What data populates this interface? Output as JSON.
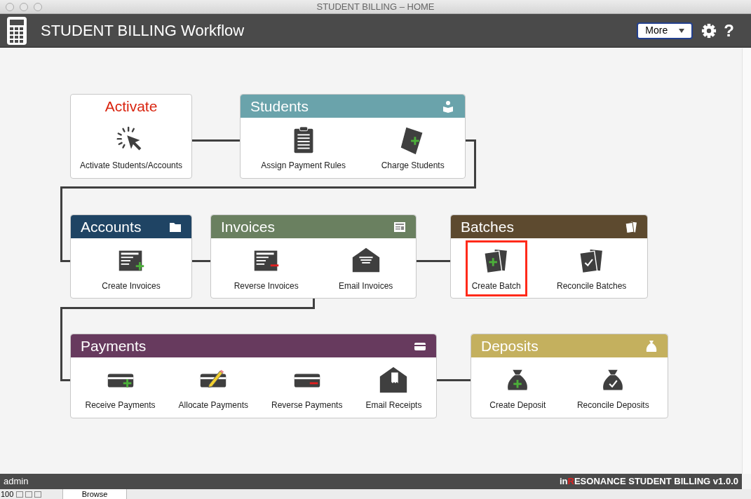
{
  "window": {
    "title": "STUDENT BILLING – HOME"
  },
  "header": {
    "title": "STUDENT BILLING Workflow",
    "menu": {
      "value": "More"
    },
    "help": "?"
  },
  "cards": [
    {
      "kind": "plain",
      "title": "Activate",
      "actions": [
        {
          "label": "Activate Students/Accounts",
          "selected": false
        }
      ]
    },
    {
      "kind": "banner",
      "title": "Students",
      "color": "#6aa3ab",
      "actions": [
        {
          "label": "Assign Payment Rules",
          "selected": false
        },
        {
          "label": "Charge Students",
          "selected": false
        }
      ]
    },
    {
      "kind": "banner",
      "title": "Accounts",
      "color": "#1f4464",
      "actions": [
        {
          "label": "Create Invoices",
          "selected": false
        }
      ]
    },
    {
      "kind": "banner",
      "title": "Invoices",
      "color": "#6a8060",
      "actions": [
        {
          "label": "Reverse Invoices",
          "selected": false
        },
        {
          "label": "Email Invoices",
          "selected": false
        }
      ]
    },
    {
      "kind": "banner",
      "title": "Batches",
      "color": "#5d4a2f",
      "actions": [
        {
          "label": "Create Batch",
          "selected": true
        },
        {
          "label": "Reconcile Batches",
          "selected": false
        }
      ]
    },
    {
      "kind": "banner",
      "title": "Payments",
      "color": "#673a5e",
      "actions": [
        {
          "label": "Receive Payments",
          "selected": false
        },
        {
          "label": "Allocate Payments",
          "selected": false
        },
        {
          "label": "Reverse Payments",
          "selected": false
        },
        {
          "label": "Email Receipts",
          "selected": false
        }
      ]
    },
    {
      "kind": "banner",
      "title": "Deposits",
      "color": "#c4b05e",
      "actions": [
        {
          "label": "Create Deposit",
          "selected": false
        },
        {
          "label": "Reconcile Deposits",
          "selected": false
        }
      ]
    }
  ],
  "status_bar": {
    "user": "admin",
    "brand": {
      "prefix": "in",
      "mark": "R",
      "rest": "ESONANCE STUDENT BILLING v1.0.0"
    }
  },
  "bottom_toolbar": {
    "zoom": "100",
    "mode": "Browse"
  }
}
